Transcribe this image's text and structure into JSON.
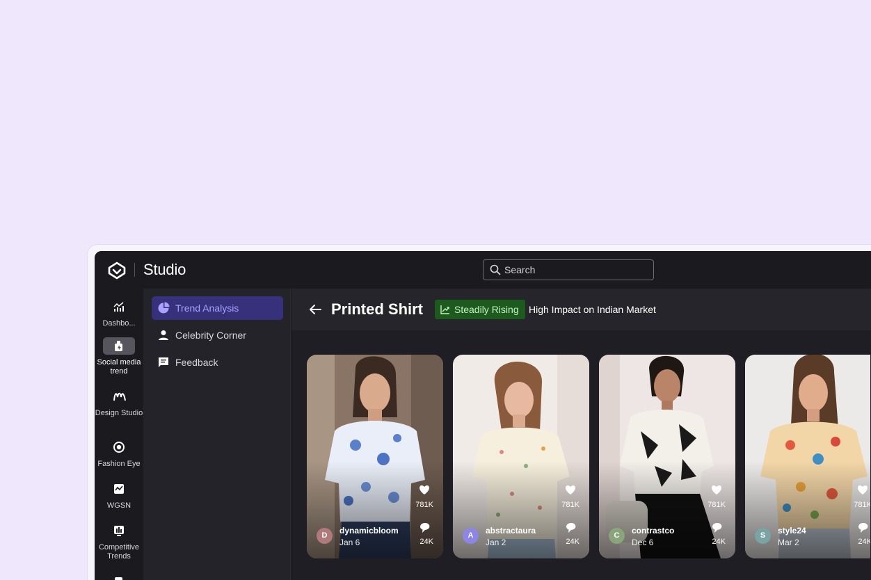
{
  "app": {
    "brand": "Studio"
  },
  "search": {
    "placeholder": "Search"
  },
  "rail": {
    "items": [
      {
        "label": "Dashbo...",
        "icon": "bar-chart-icon"
      },
      {
        "label": "Social media trend",
        "icon": "social-trend-icon",
        "active": true
      },
      {
        "label": "Design Studio",
        "icon": "design-wave-icon"
      },
      {
        "label": "Fashion Eye",
        "icon": "eye-lens-icon"
      },
      {
        "label": "WGSN",
        "icon": "pulse-chart-icon"
      },
      {
        "label": "Competitive Trends",
        "icon": "competitor-chart-icon"
      }
    ]
  },
  "submenu": {
    "items": [
      {
        "label": "Trend Analysis",
        "icon": "pie-chart-icon",
        "active": true
      },
      {
        "label": "Celebrity Corner",
        "icon": "person-icon"
      },
      {
        "label": "Feedback",
        "icon": "feedback-icon"
      }
    ]
  },
  "header": {
    "title": "Printed Shirt",
    "trend_status": "Steadily Rising",
    "impact": "High Impact on Indian Market"
  },
  "colors": {
    "accent": "#36317a",
    "accent_text": "#a9a2ff",
    "badge_bg": "#1c5a1e",
    "page_bg": "#efe8fc"
  },
  "cards": [
    {
      "avatar_letter": "D",
      "username": "dynamicbloom",
      "date": "Jan 6",
      "likes": "781K",
      "comments": "24K",
      "avatar_color": "#b07a7a"
    },
    {
      "avatar_letter": "A",
      "username": "abstractaura",
      "date": "Jan 2",
      "likes": "781K",
      "comments": "24K",
      "avatar_color": "#8d86e6"
    },
    {
      "avatar_letter": "C",
      "username": "contrastco",
      "date": "Dec 6",
      "likes": "781K",
      "comments": "24K",
      "avatar_color": "#8aa57c"
    },
    {
      "avatar_letter": "S",
      "username": "style24",
      "date": "Mar 2",
      "likes": "781K",
      "comments": "24K",
      "avatar_color": "#7aa3a3"
    }
  ]
}
